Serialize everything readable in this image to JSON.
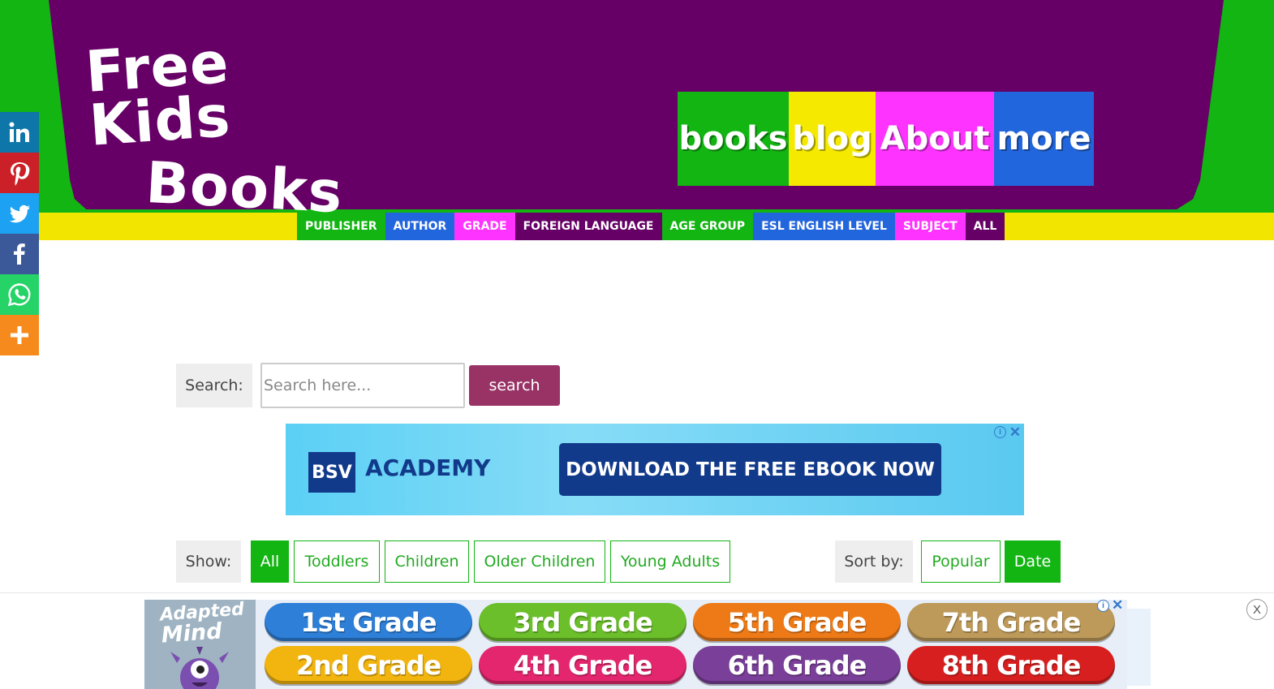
{
  "logo": {
    "line1": "Free Kids",
    "line2": "Books"
  },
  "main_menu": [
    {
      "label": "books",
      "color": "#12b512"
    },
    {
      "label": "blog",
      "color": "#f5e900"
    },
    {
      "label": "About",
      "color": "#ff33ff"
    },
    {
      "label": "more",
      "color": "#2266dd"
    }
  ],
  "sub_nav": [
    {
      "label": "PUBLISHER",
      "color": "#12b512"
    },
    {
      "label": "AUTHOR",
      "color": "#2266dd"
    },
    {
      "label": "GRADE",
      "color": "#ff33ff"
    },
    {
      "label": "FOREIGN LANGUAGE",
      "color": "#660066"
    },
    {
      "label": "AGE GROUP",
      "color": "#12b512"
    },
    {
      "label": "ESL ENGLISH LEVEL",
      "color": "#2266dd"
    },
    {
      "label": "SUBJECT",
      "color": "#ff33ff"
    },
    {
      "label": "ALL",
      "color": "#660066"
    }
  ],
  "social": [
    {
      "icon": "linkedin-icon",
      "color": "#0e76a8"
    },
    {
      "icon": "pinterest-icon",
      "color": "#cb2027"
    },
    {
      "icon": "twitter-icon",
      "color": "#1da1f2"
    },
    {
      "icon": "facebook-icon",
      "color": "#3b5998"
    },
    {
      "icon": "whatsapp-icon",
      "color": "#25d366"
    },
    {
      "icon": "more-icon",
      "color": "#f68a1d"
    }
  ],
  "search": {
    "label": "Search:",
    "placeholder": "Search here...",
    "button": "search"
  },
  "ad_top": {
    "logo": "BSV",
    "brand": "ACADEMY",
    "cta": "DOWNLOAD THE FREE EBOOK NOW",
    "info": "i",
    "close": "✕"
  },
  "show": {
    "label": "Show:",
    "options": [
      "All",
      "Toddlers",
      "Children",
      "Older Children",
      "Young Adults"
    ],
    "active": "All"
  },
  "sort": {
    "label": "Sort by:",
    "options": [
      "Popular",
      "Date"
    ],
    "active": "Date"
  },
  "ad_bottom": {
    "logo_line1": "Adapted",
    "logo_line2": "Mind",
    "grades": [
      {
        "label": "1st Grade",
        "color": "#2d7fd8"
      },
      {
        "label": "3rd Grade",
        "color": "#6bbf2a"
      },
      {
        "label": "5th Grade",
        "color": "#ee7a17"
      },
      {
        "label": "7th Grade",
        "color": "#bd9a5a"
      },
      {
        "label": "2nd Grade",
        "color": "#f2b40f"
      },
      {
        "label": "4th Grade",
        "color": "#e4266e"
      },
      {
        "label": "6th Grade",
        "color": "#7a3f98"
      },
      {
        "label": "8th Grade",
        "color": "#d81f1f"
      }
    ],
    "info": "i",
    "close": "✕",
    "bar_close": "X"
  }
}
